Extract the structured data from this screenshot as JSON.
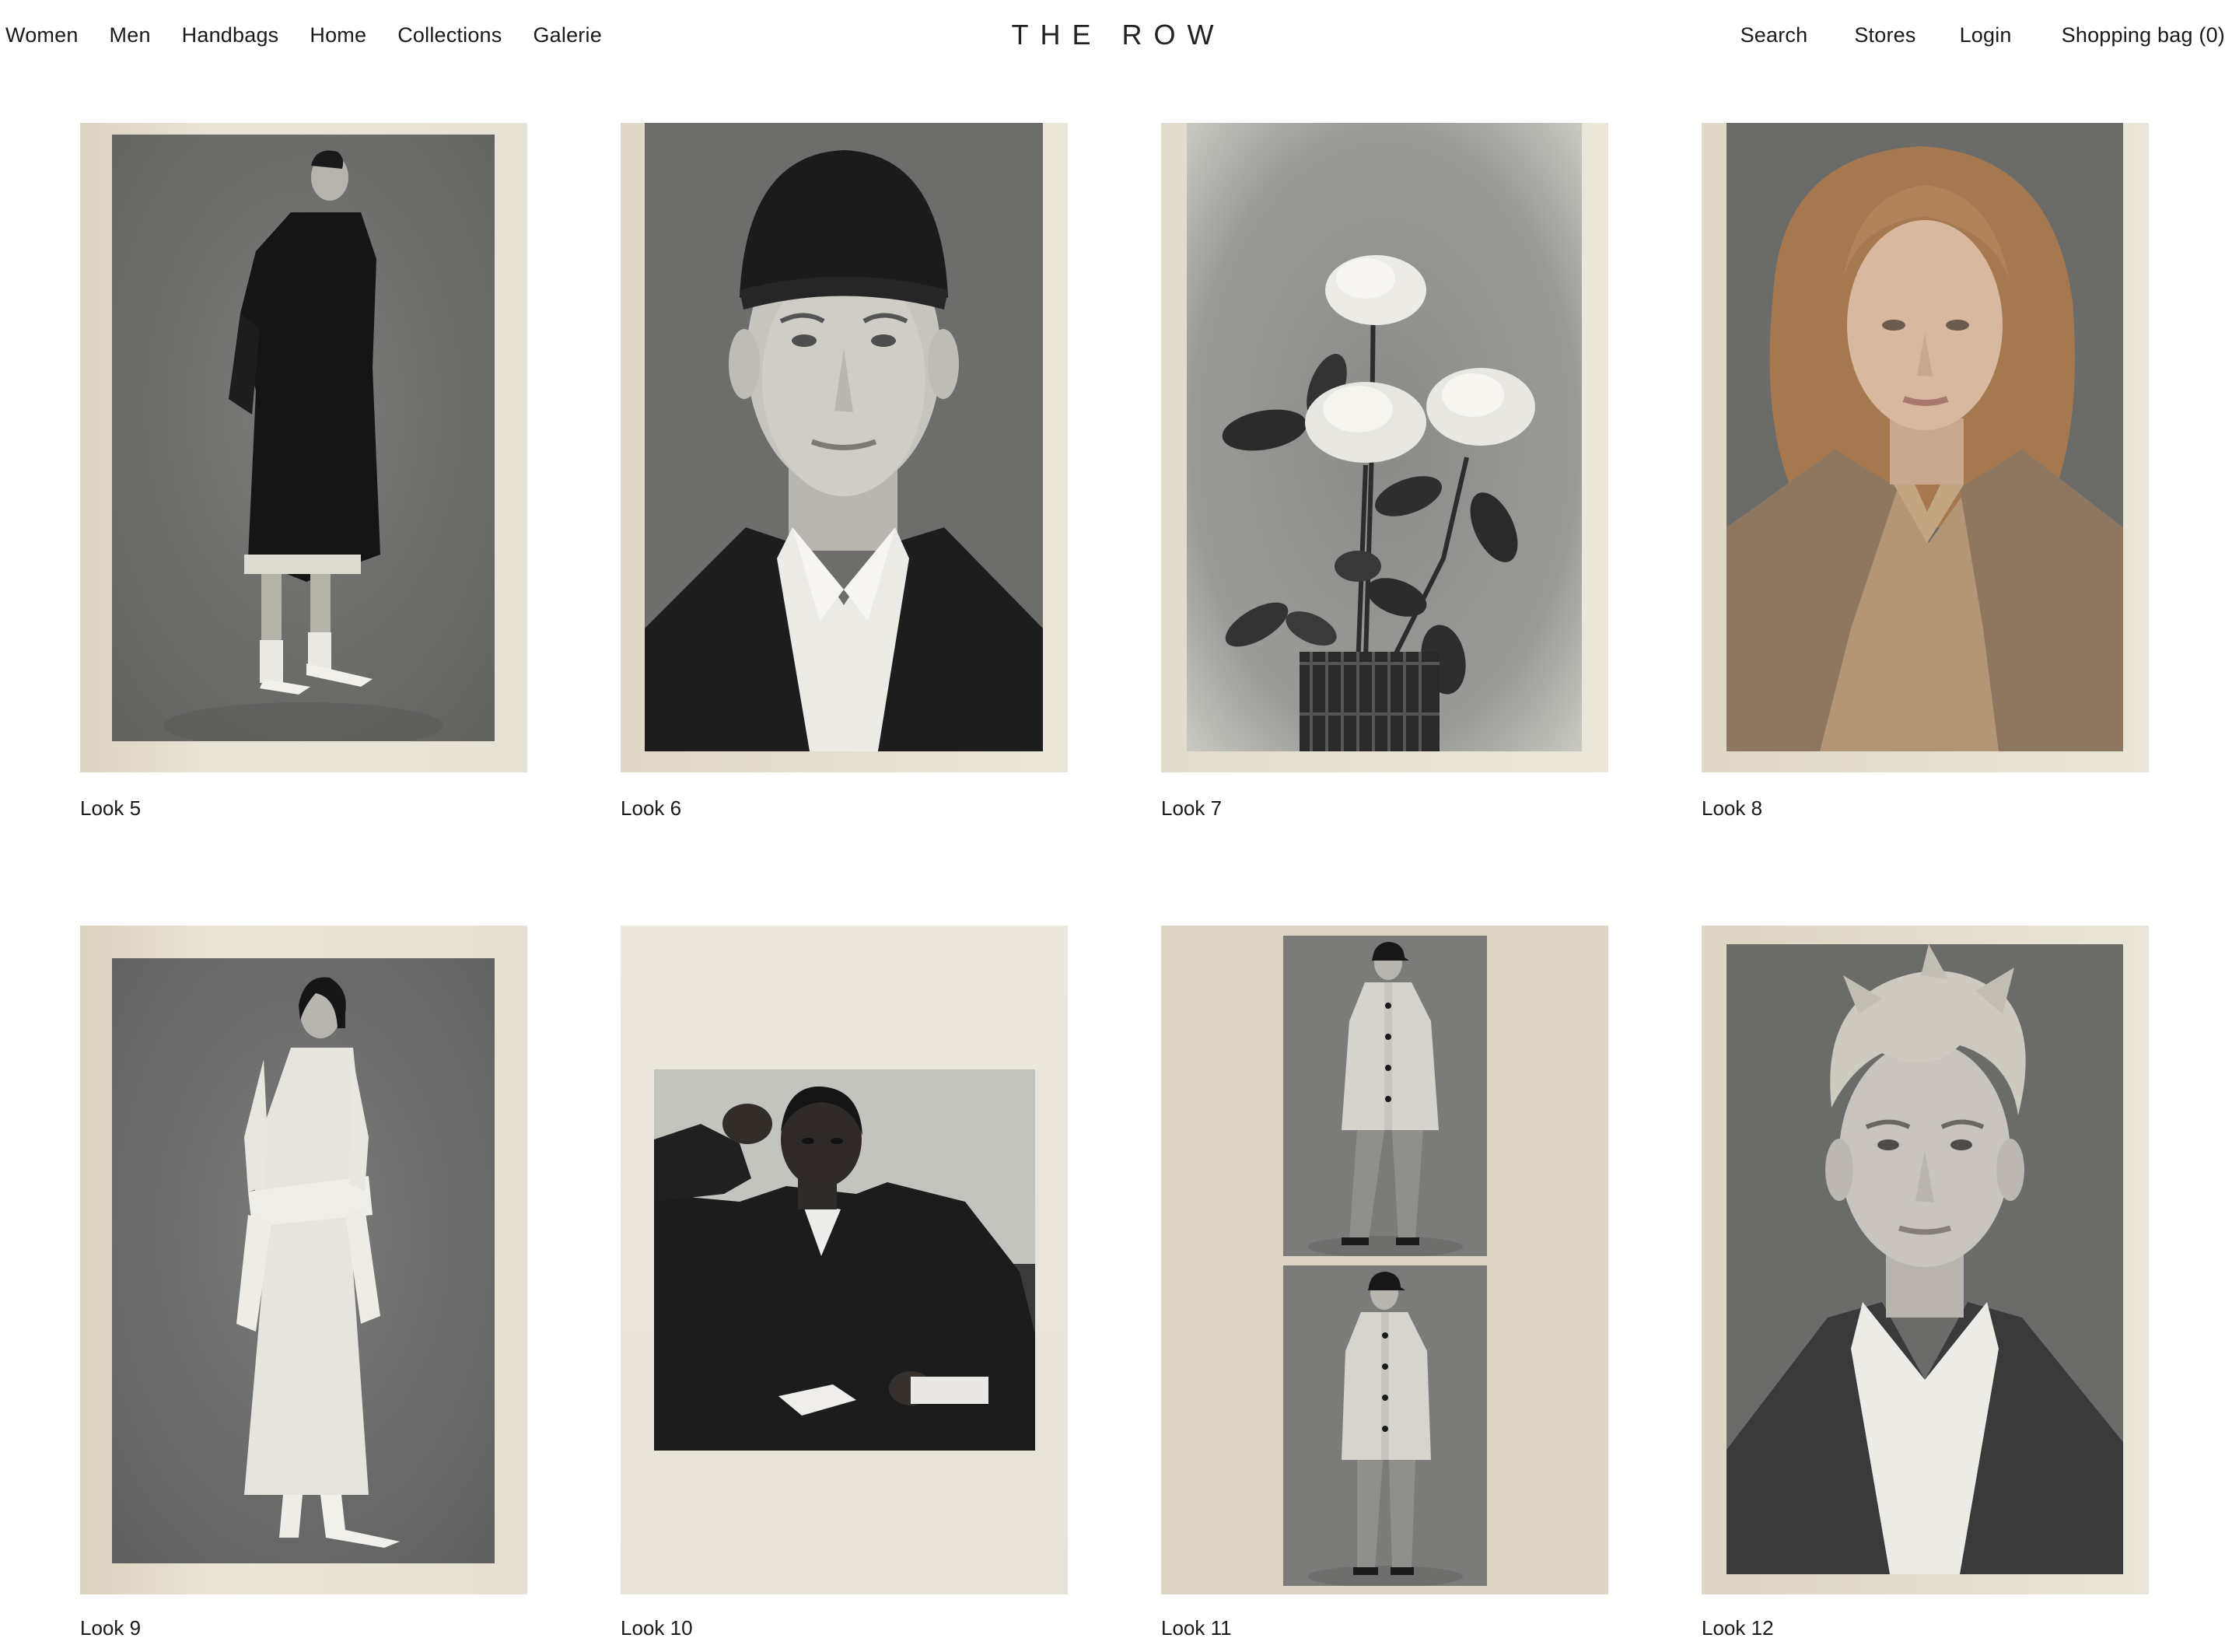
{
  "nav": {
    "left": [
      "Women",
      "Men",
      "Handbags",
      "Home",
      "Collections",
      "Galerie"
    ],
    "logo": "THE ROW",
    "right": {
      "search": "Search",
      "stores": "Stores",
      "login": "Login",
      "bag": "Shopping bag (0)"
    }
  },
  "looks": [
    {
      "label": "Look 5",
      "subject": "standing woman in black coat, white socks"
    },
    {
      "label": "Look 6",
      "subject": "portrait of man in black cap and suit"
    },
    {
      "label": "Look 7",
      "subject": "white roses in wicker vase"
    },
    {
      "label": "Look 8",
      "subject": "woman with curly hair in camel knit"
    },
    {
      "label": "Look 9",
      "subject": "woman in white dress with tied sweater"
    },
    {
      "label": "Look 10",
      "subject": "seated man in black suit"
    },
    {
      "label": "Look 11",
      "subject": "two frames of model in light coat and cap"
    },
    {
      "label": "Look 12",
      "subject": "portrait of blond man in tweed jacket"
    }
  ],
  "colors": {
    "frame_cream": "#e6e1d4",
    "frame_cream_light": "#ece8dd",
    "frame_taupe": "#ddd5c6",
    "photo_grey": "#6f706e",
    "photo_dark": "#1c1c1c",
    "photo_light": "#bdbdb8",
    "camel": "#b49878",
    "text": "#1a1a1a"
  }
}
